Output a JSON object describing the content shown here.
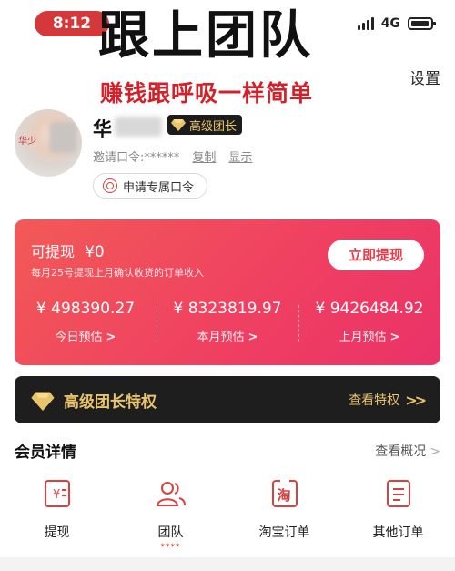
{
  "status_bar": {
    "time": "8:12",
    "network": "4G",
    "icons": [
      "signal-icon",
      "battery-icon"
    ]
  },
  "overlay": {
    "title": "跟上团队",
    "caption": "赚钱跟呼吸一样简单"
  },
  "header": {
    "settings_label": "设置"
  },
  "profile": {
    "name": "华",
    "level_badge": "高级团长",
    "avatar_text": "华少",
    "invite_code_label": "邀请口令:******",
    "copy_label": "复制",
    "show_label": "显示",
    "apply_button_label": "申请专属口令"
  },
  "earnings": {
    "withdrawable_label": "可提现",
    "withdrawable_amount": "¥0",
    "note": "每月25号提现上月确认收货的订单收入",
    "withdraw_button": "立即提现",
    "stats": [
      {
        "value": "¥ 498390.27",
        "label": "今日预估"
      },
      {
        "value": "¥ 8323819.97",
        "label": "本月预估"
      },
      {
        "value": "¥ 9426484.92",
        "label": "上月预估"
      }
    ],
    "arrow": ">"
  },
  "privileges": {
    "title": "高级团长特权",
    "action": "查看特权",
    "chevron": ">>"
  },
  "member_details": {
    "title": "会员详情",
    "overview_link": "查看概况",
    "overview_chevron": ">",
    "items": [
      {
        "label": "提现",
        "icon": "withdraw-icon"
      },
      {
        "label": "团队",
        "icon": "team-icon",
        "dots": "****"
      },
      {
        "label": "淘宝订单",
        "icon": "taobao-order-icon",
        "icon_text": "淘"
      },
      {
        "label": "其他订单",
        "icon": "other-orders-icon"
      }
    ]
  },
  "colors": {
    "accent_red": "#e83b4a",
    "card_gradient_start": "#f25a57",
    "card_gradient_end": "#ea3268",
    "gold": "#e9c46a",
    "dark_bar": "#1e1e1e"
  }
}
